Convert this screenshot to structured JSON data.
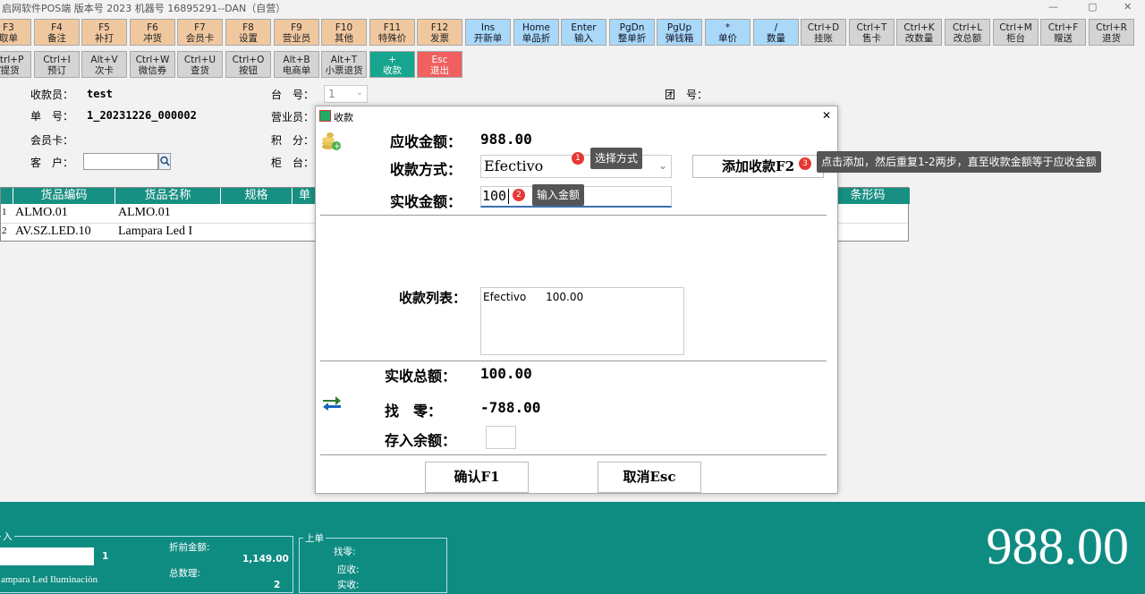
{
  "window": {
    "title": "启网软件POS端 版本号 2023 机器号 16895291--DAN（自营）",
    "min": "—",
    "max": "▢",
    "close": "✕"
  },
  "fkeys_row1": [
    {
      "k": "F3",
      "l": "取单",
      "c": "tan"
    },
    {
      "k": "F4",
      "l": "备注",
      "c": "tan"
    },
    {
      "k": "F5",
      "l": "补打",
      "c": "tan"
    },
    {
      "k": "F6",
      "l": "冲货",
      "c": "tan"
    },
    {
      "k": "F7",
      "l": "会员卡",
      "c": "tan"
    },
    {
      "k": "F8",
      "l": "设置",
      "c": "tan"
    },
    {
      "k": "F9",
      "l": "营业员",
      "c": "tan"
    },
    {
      "k": "F10",
      "l": "其他",
      "c": "tan"
    },
    {
      "k": "F11",
      "l": "特殊价",
      "c": "tan"
    },
    {
      "k": "F12",
      "l": "发票",
      "c": "tan"
    },
    {
      "k": "Ins",
      "l": "开新单",
      "c": "blue"
    },
    {
      "k": "Home",
      "l": "单品折",
      "c": "blue"
    },
    {
      "k": "Enter",
      "l": "输入",
      "c": "blue"
    },
    {
      "k": "PgDn",
      "l": "整单折",
      "c": "blue"
    },
    {
      "k": "PgUp",
      "l": "弹钱箱",
      "c": "blue"
    },
    {
      "k": "*",
      "l": "单价",
      "c": "blue"
    },
    {
      "k": "/",
      "l": "数量",
      "c": "blue"
    },
    {
      "k": "Ctrl+D",
      "l": "挂账",
      "c": "grey"
    },
    {
      "k": "Ctrl+T",
      "l": "售卡",
      "c": "grey"
    },
    {
      "k": "Ctrl+K",
      "l": "改数量",
      "c": "grey"
    },
    {
      "k": "Ctrl+L",
      "l": "改总额",
      "c": "grey"
    },
    {
      "k": "Ctrl+M",
      "l": "柜台",
      "c": "grey"
    },
    {
      "k": "Ctrl+F",
      "l": "赠送",
      "c": "grey"
    },
    {
      "k": "Ctrl+R",
      "l": "退货",
      "c": "grey"
    }
  ],
  "fkeys_row2": [
    {
      "k": "Ctrl+P",
      "l": "/提货",
      "c": "grey"
    },
    {
      "k": "Ctrl+I",
      "l": "预订",
      "c": "grey"
    },
    {
      "k": "Alt+V",
      "l": "次卡",
      "c": "grey"
    },
    {
      "k": "Ctrl+W",
      "l": "微信券",
      "c": "grey"
    },
    {
      "k": "Ctrl+U",
      "l": "查货",
      "c": "grey"
    },
    {
      "k": "Ctrl+O",
      "l": "按钮",
      "c": "grey"
    },
    {
      "k": "Alt+B",
      "l": "电商单",
      "c": "grey"
    },
    {
      "k": "Alt+T",
      "l": "小票退货",
      "c": "grey"
    },
    {
      "k": "+",
      "l": "收款",
      "c": "teal"
    },
    {
      "k": "Esc",
      "l": "退出",
      "c": "red"
    }
  ],
  "info": {
    "cashier_label": "收款员：",
    "cashier": "test",
    "order_label": "单　号：",
    "order": "1_20231226_000002",
    "member_label": "会员卡：",
    "customer_label": "客　户：",
    "station_label": "台　号：",
    "station": "1",
    "clerk_label": "营业员：",
    "points_label": "积　分：",
    "counter_label": "柜　台：",
    "group_label": "团　号："
  },
  "grid": {
    "headers": [
      "货品编码",
      "货品名称",
      "规格",
      "单",
      "条形码"
    ],
    "rows": [
      {
        "num": "1",
        "code": "ALMO.01",
        "name": "ALMO.01"
      },
      {
        "num": "2",
        "code": "AV.SZ.LED.10",
        "name": "Lampara Led I"
      }
    ]
  },
  "bottom": {
    "input_label": "入",
    "qty": "1",
    "item_desc": "ampara Led Iluminaciòn",
    "pre_discount_label": "折前金额:",
    "pre_discount": "1,149.00",
    "total_qty_label": "总数理:",
    "total_qty": "2",
    "prev_label": "上单",
    "change_label": "找零:",
    "due_label": "应收:",
    "received_label": "实收:",
    "big_total": "988.00"
  },
  "dialog": {
    "title": "收款",
    "close": "✕",
    "due_label": "应收金额：",
    "due": "988.00",
    "method_label": "收款方式：",
    "method": "Efectivo",
    "received_label": "实收金额：",
    "received": "100",
    "add_button": "添加收款F2",
    "list_label": "收款列表：",
    "list": [
      {
        "method": "Efectivo",
        "amount": "100.00"
      }
    ],
    "total_received_label": "实收总额：",
    "total_received": "100.00",
    "change_label": "找　零：",
    "change": "-788.00",
    "balance_label": "存入余额：",
    "confirm_button": "确认F1",
    "cancel_button": "取消Esc",
    "tip1_num": "1",
    "tip1": "选择方式",
    "tip2_num": "2",
    "tip2": "输入金额",
    "tip3_num": "3",
    "tip3": "点击添加，然后重复1-2两步，直至收款金额等于应收金额"
  }
}
